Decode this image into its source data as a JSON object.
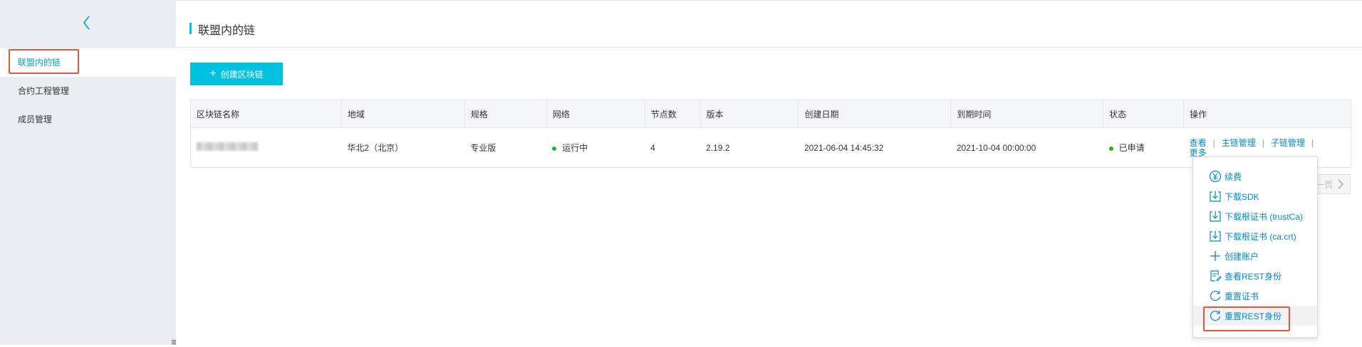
{
  "sidebar": {
    "items": [
      {
        "label": "联盟内的链",
        "active": true
      },
      {
        "label": "合约工程管理",
        "active": false
      },
      {
        "label": "成员管理",
        "active": false
      }
    ]
  },
  "header": {
    "title": "联盟内的链"
  },
  "toolbar": {
    "create_label": "创建区块链"
  },
  "table": {
    "headers": [
      "区块链名称",
      "地域",
      "规格",
      "网络",
      "节点数",
      "版本",
      "创建日期",
      "到期时间",
      "状态",
      "操作"
    ],
    "rows": [
      {
        "region": "华北2（北京）",
        "spec": "专业版",
        "network": "运行中",
        "nodes": "4",
        "version": "2.19.2",
        "created": "2021-06-04 14:45:32",
        "expires": "2021-10-04 00:00:00",
        "status": "已申请",
        "ops": {
          "view": "查看",
          "main": "主链管理",
          "sub": "子链管理",
          "more": "更多",
          "sep": "|"
        }
      }
    ]
  },
  "pager": {
    "label": "一页"
  },
  "menu": {
    "items": [
      {
        "label": "续费",
        "icon": "yen-circle-icon"
      },
      {
        "label": "下载SDK",
        "icon": "download-icon"
      },
      {
        "label": "下载根证书 (trustCa)",
        "icon": "download-icon"
      },
      {
        "label": "下载根证书 (ca.crt)",
        "icon": "download-icon"
      },
      {
        "label": "创建账户",
        "icon": "plus-icon"
      },
      {
        "label": "查看REST身份",
        "icon": "document-edit-icon"
      },
      {
        "label": "重置证书",
        "icon": "refresh-icon"
      },
      {
        "label": "重置REST身份",
        "icon": "refresh-icon"
      }
    ]
  },
  "colors": {
    "accent": "#00c1de",
    "link": "#0088cc",
    "highlight": "#e8563c",
    "running": "#1fb31f"
  }
}
